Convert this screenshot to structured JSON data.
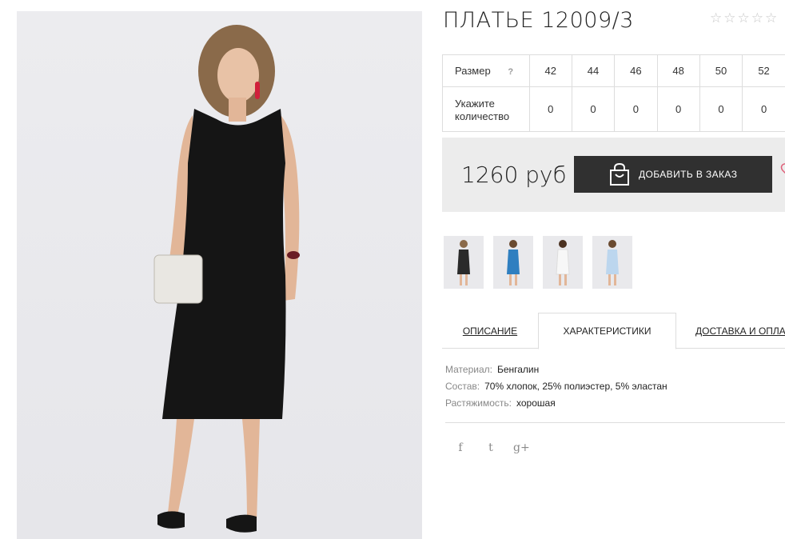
{
  "product": {
    "title": "ПЛАТЬЕ 12009/3",
    "rating_stars": [
      "☆",
      "☆",
      "☆",
      "☆",
      "☆"
    ]
  },
  "sizes": {
    "size_label": "Размер",
    "help_icon": "?",
    "qty_label_line1": "Укажите",
    "qty_label_line2": "количество",
    "values": [
      "42",
      "44",
      "46",
      "48",
      "50",
      "52"
    ],
    "quantities": [
      "0",
      "0",
      "0",
      "0",
      "0",
      "0"
    ]
  },
  "purchase": {
    "price": "1260 руб",
    "add_button_label": "ДОБАВИТЬ В ЗАКАЗ",
    "accent_color": "#303030"
  },
  "thumbnails": [
    {
      "name": "thumb-black-dress",
      "dress_color": "#2a2a2a"
    },
    {
      "name": "thumb-blue-dress",
      "dress_color": "#2f7fc0"
    },
    {
      "name": "thumb-white-dress",
      "dress_color": "#f5f5f5"
    },
    {
      "name": "thumb-lightblue-dress",
      "dress_color": "#bcd6ee"
    }
  ],
  "tabs": {
    "description": "ОПИСАНИЕ",
    "characteristics": "ХАРАКТЕРИСТИКИ",
    "delivery": "ДОСТАВКА И ОПЛАТА"
  },
  "characteristics": [
    {
      "key": "Материал:",
      "value": "Бенгалин"
    },
    {
      "key": "Состав:",
      "value": "70% хлопок, 25% полиэстер, 5% эластан"
    },
    {
      "key": "Растяжимость:",
      "value": "хорошая"
    }
  ],
  "social": {
    "facebook": "f",
    "twitter": "t",
    "googleplus": "g+"
  }
}
